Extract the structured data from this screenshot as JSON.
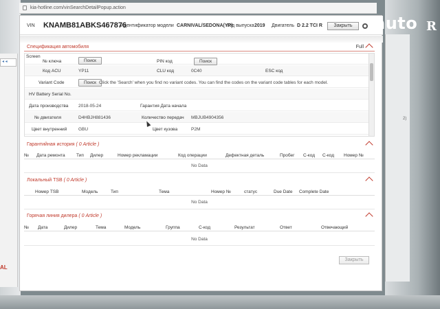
{
  "browser": {
    "url": "kia-hotline.com/vinSearchDetailPopup.action"
  },
  "watermark": {
    "text": "auto",
    "text2": "R"
  },
  "header": {
    "vin_label": "VIN",
    "vin": "KNAMB81ABKS467876",
    "model_label": "Идентификатор модели",
    "model": "CARNIVAL/SEDONA(YP)",
    "year_label": "Год выпуска",
    "year": "2019",
    "engine_label": "Двигатель",
    "engine": "D 2.2 TCI R",
    "close_label": "Закрыть"
  },
  "spec": {
    "title": "Спецификация автомобиля",
    "full_label": "Full",
    "screen_label": "Screen",
    "key_no_label": "№ ключа",
    "search_label": "Поиск",
    "pin_label": "PIN код",
    "acu_label": "Код ACU",
    "acu_value": "YP11",
    "clu_label": "CLU код",
    "clu_value": "0C40",
    "esc_label": "ESC код",
    "variant_label": "Variant Code",
    "variant_hint": "Click the 'Search' when you find no variant codes. You can find the codes on the variant code tables for each model.",
    "hv_label": "HV Battery Serial No.",
    "prod_date_label": "Дата производства",
    "prod_date": "2018-05-24",
    "warranty_label": "Гарантия Дата начала",
    "engine_no_label": "№ двигателя",
    "engine_no": "D4HBJH881436",
    "gears_label": "Количество передач",
    "gears_value": "MBJUB4904356",
    "interior_label": "Цвет внутренний",
    "interior_value": "GBU",
    "body_color_label": "Цвет кузова",
    "body_color_value": "P2M"
  },
  "warranty": {
    "title": "Гарантийная история",
    "count": "( 0 Article )",
    "columns": [
      "№",
      "Дата ремонта",
      "Тип",
      "Дилер",
      "Номер рекламации",
      "Код операции",
      "Дефектная деталь",
      "Пробег",
      "С-код",
      "С-код",
      "Номер №"
    ],
    "empty": "No Data"
  },
  "tsb": {
    "title": "Локальный TSB",
    "count": "( 0 Article )",
    "columns": [
      "Номер TSB",
      "Модель",
      "Тип",
      "Тема",
      "Номер №",
      "статус",
      "Due Date",
      "Complete Date"
    ],
    "empty": "No Data"
  },
  "hotline": {
    "title": "Горячая линия дилера",
    "count": "( 0 Article )",
    "columns": [
      "№",
      "Дата",
      "Дилер",
      "Тема",
      "Модель",
      "Группа",
      "С-код",
      "Результат",
      "Ответ",
      "Отвечающий"
    ],
    "empty": "No Data"
  },
  "footer": {
    "close_label": "Закрыть"
  }
}
